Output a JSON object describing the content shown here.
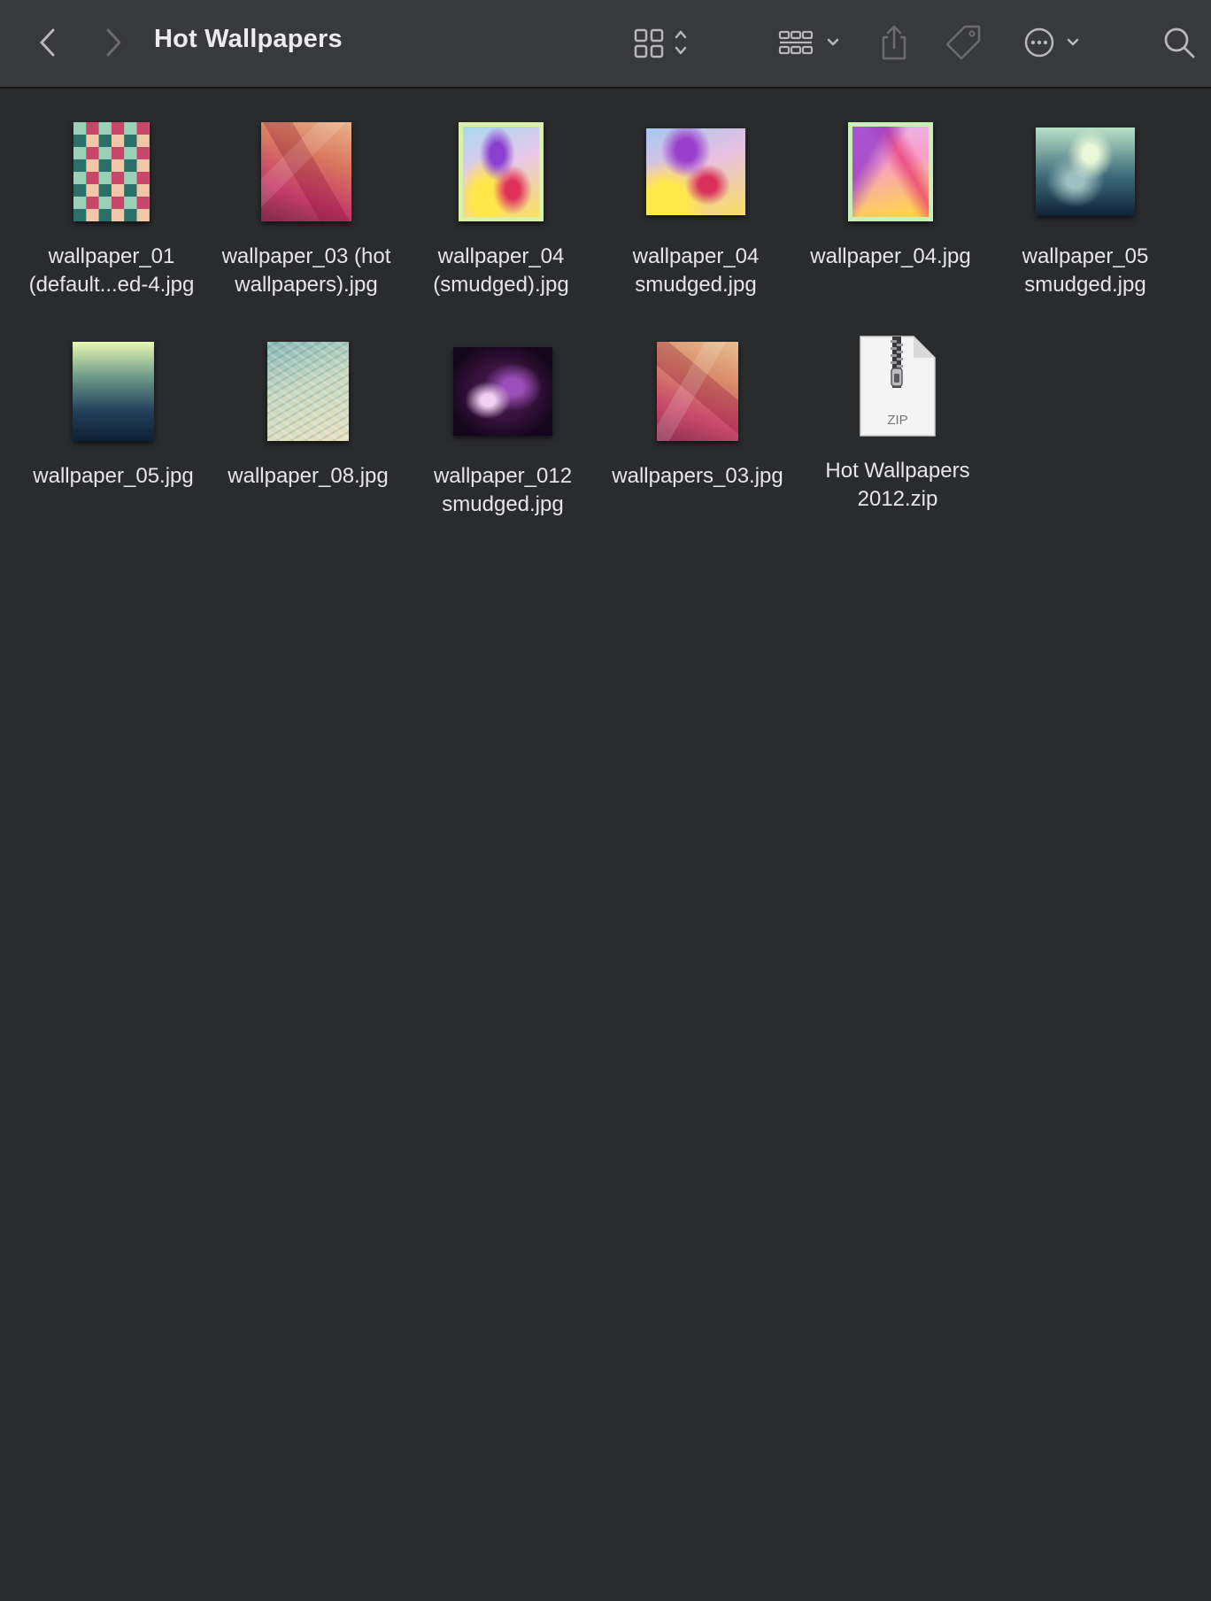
{
  "window": {
    "title": "Hot Wallpapers"
  },
  "toolbar": {
    "back_icon": "chevron-left-icon",
    "forward_icon": "chevron-right-icon",
    "view_icon": "icon-grid-view-icon",
    "group_icon": "group-by-icon",
    "share_icon": "share-icon",
    "tag_icon": "tag-icon",
    "more_icon": "ellipsis-circle-icon",
    "search_icon": "search-icon"
  },
  "files": [
    {
      "name": "wallpaper_01\n(default...ed-4.jpg",
      "thumb": "quilt"
    },
    {
      "name": "wallpaper_03 (hot\nwallpapers).jpg",
      "thumb": "poly"
    },
    {
      "name": "wallpaper_04\n(smudged).jpg",
      "thumb": "smudge-framed"
    },
    {
      "name": "wallpaper_04\nsmudged.jpg",
      "thumb": "smudge"
    },
    {
      "name": "wallpaper_04.jpg",
      "thumb": "framed-bright"
    },
    {
      "name": "wallpaper_05\nsmudged.jpg",
      "thumb": "teal-smudge"
    },
    {
      "name": "wallpaper_05.jpg",
      "thumb": "gradient"
    },
    {
      "name": "wallpaper_08.jpg",
      "thumb": "texture"
    },
    {
      "name": "wallpaper_012\nsmudged.jpg",
      "thumb": "purple"
    },
    {
      "name": "wallpapers_03.jpg",
      "thumb": "poly2"
    },
    {
      "name": "Hot Wallpapers\n2012.zip",
      "thumb": "zip",
      "badge": "ZIP"
    }
  ],
  "colors": {
    "toolbar_bg": "#38393b",
    "content_bg": "#2a2b2d",
    "text": "#e6e6e8"
  }
}
